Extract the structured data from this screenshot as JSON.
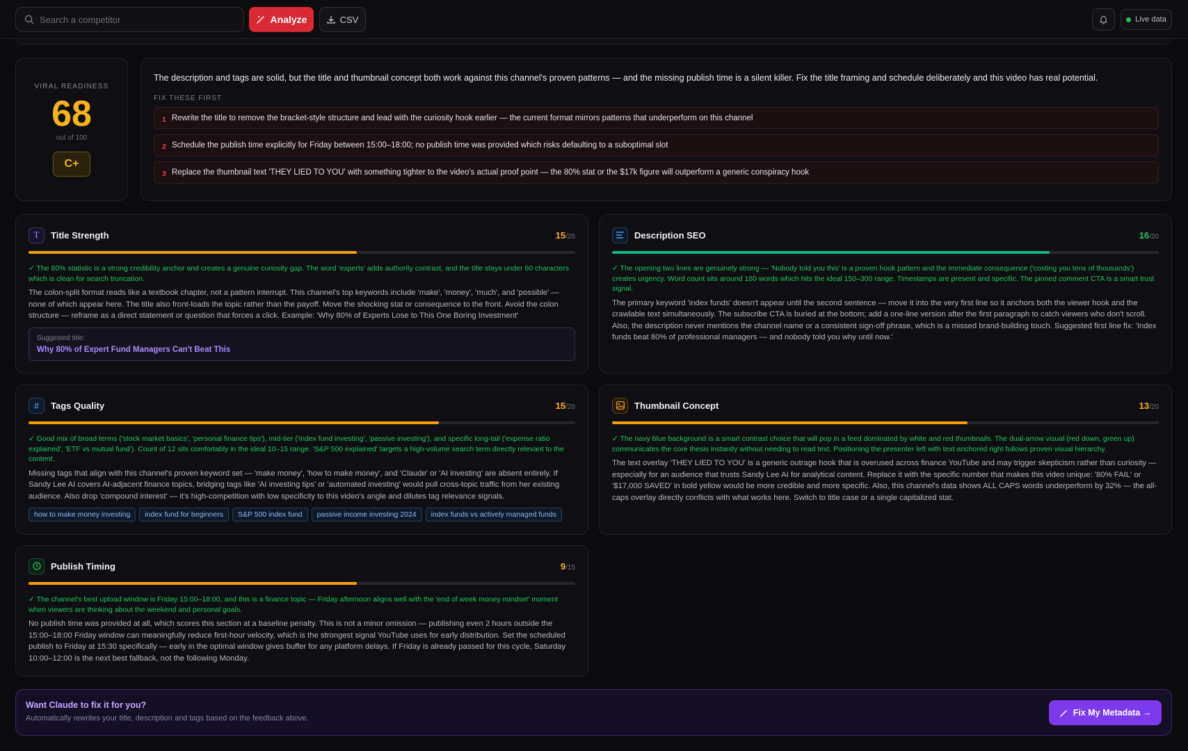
{
  "topbar": {
    "search_placeholder": "Search a competitor",
    "analyze_label": "Analyze",
    "csv_label": "CSV",
    "live_label": "Live data"
  },
  "score": {
    "label": "VIRAL READINESS",
    "value": "68",
    "out_of": "out of 100",
    "grade": "C+"
  },
  "summary": {
    "text": "The description and tags are solid, but the title and thumbnail concept both work against this channel's proven patterns — and the missing publish time is a silent killer. Fix the title framing and schedule deliberately and this video has real potential.",
    "fix_title": "FIX THESE FIRST",
    "fixes": [
      {
        "num": "1",
        "text": "Rewrite the title to remove the bracket-style structure and lead with the curiosity hook earlier — the current format mirrors patterns that underperform on this channel"
      },
      {
        "num": "2",
        "text": "Schedule the publish time explicitly for Friday between 15:00–18:00; no publish time was provided which risks defaulting to a suboptimal slot"
      },
      {
        "num": "3",
        "text": "Replace the thumbnail text 'THEY LIED TO YOU' with something tighter to the video's actual proof point — the 80% stat or the $17k figure will outperform a generic conspiracy hook"
      }
    ]
  },
  "sections": {
    "title": {
      "name": "Title Strength",
      "score": "15",
      "max": "/25",
      "progress": 0.6,
      "good": "✓ The 80% statistic is a strong credibility anchor and creates a genuine curiosity gap. The word 'experts' adds authority contrast, and the title stays under 60 characters which is clean for search truncation.",
      "body": "The colon-split format reads like a textbook chapter, not a pattern interrupt. This channel's top keywords include 'make', 'money', 'much', and 'possible' — none of which appear here. The title also front-loads the topic rather than the payoff. Move the shocking stat or consequence to the front. Avoid the colon structure — reframe as a direct statement or question that forces a click. Example: 'Why 80% of Experts Lose to This One Boring Investment'",
      "suggest_label": "Suggested title:",
      "suggest_value": "Why 80% of Expert Fund Managers Can't Beat This"
    },
    "description": {
      "name": "Description SEO",
      "score": "16",
      "max": "/20",
      "progress": 0.8,
      "good": "✓ The opening two lines are genuinely strong — 'Nobody told you this' is a proven hook pattern and the immediate consequence ('costing you tens of thousands') creates urgency. Word count sits around 180 words which hits the ideal 150–300 range. Timestamps are present and specific. The pinned comment CTA is a smart trust signal.",
      "body": "The primary keyword 'index funds' doesn't appear until the second sentence — move it into the very first line so it anchors both the viewer hook and the crawlable text simultaneously. The subscribe CTA is buried at the bottom; add a one-line version after the first paragraph to catch viewers who don't scroll. Also, the description never mentions the channel name or a consistent sign-off phrase, which is a missed brand-building touch. Suggested first line fix: 'Index funds beat 80% of professional managers — and nobody told you why until now.'"
    },
    "tags": {
      "name": "Tags Quality",
      "score": "15",
      "max": "/20",
      "progress": 0.75,
      "good": "✓ Good mix of broad terms ('stock market basics', 'personal finance tips'), mid-tier ('index fund investing', 'passive investing'), and specific long-tail ('expense ratio explained', 'ETF vs mutual fund'). Count of 12 sits comfortably in the ideal 10–15 range. 'S&P 500 explained' targets a high-volume search term directly relevant to the content.",
      "body": "Missing tags that align with this channel's proven keyword set — 'make money', 'how to make money', and 'Claude' or 'AI investing' are absent entirely. If Sandy Lee AI covers AI-adjacent finance topics, bridging tags like 'AI investing tips' or 'automated investing' would pull cross-topic traffic from her existing audience. Also drop 'compound interest' — it's high-competition with low specificity to this video's angle and dilutes tag relevance signals.",
      "chips": [
        "how to make money investing",
        "index fund for beginners",
        "S&P 500 index fund",
        "passive income investing 2024",
        "index funds vs actively managed funds"
      ]
    },
    "thumbnail": {
      "name": "Thumbnail Concept",
      "score": "13",
      "max": "/20",
      "progress": 0.65,
      "good": "✓ The navy blue background is a smart contrast choice that will pop in a feed dominated by white and red thumbnails. The dual-arrow visual (red down, green up) communicates the core thesis instantly without needing to read text. Positioning the presenter left with text anchored right follows proven visual hierarchy.",
      "body": "The text overlay 'THEY LIED TO YOU' is a generic outrage hook that is overused across finance YouTube and may trigger skepticism rather than curiosity — especially for an audience that trusts Sandy Lee AI for analytical content. Replace it with the specific number that makes this video unique: '80% FAIL' or '$17,000 SAVED' in bold yellow would be more credible and more specific. Also, this channel's data shows ALL CAPS words underperform by 32% — the all-caps overlay directly conflicts with what works here. Switch to title case or a single capitalized stat."
    },
    "timing": {
      "name": "Publish Timing",
      "score": "9",
      "max": "/15",
      "progress": 0.6,
      "good": "✓ The channel's best upload window is Friday 15:00–18:00, and this is a finance topic — Friday afternoon aligns well with the 'end of week money mindset' moment when viewers are thinking about the weekend and personal goals.",
      "body": "No publish time was provided at all, which scores this section at a baseline penalty. This is not a minor omission — publishing even 2 hours outside the 15:00–18:00 Friday window can meaningfully reduce first-hour velocity, which is the strongest signal YouTube uses for early distribution. Set the scheduled publish to Friday at 15:30 specifically — early in the optimal window gives buffer for any platform delays. If Friday is already passed for this cycle, Saturday 10:00–12:00 is the next best fallback, not the following Monday."
    }
  },
  "cta": {
    "title": "Want Claude to fix it for you?",
    "subtitle": "Automatically rewrites your title, description and tags based on the feedback above.",
    "button": "Fix My Metadata →"
  },
  "colors": {
    "accent_red": "#d92a33",
    "score_amber": "#f5b21b",
    "good_green": "#22c55e",
    "purple": "#7c3aed"
  },
  "icons": {
    "search": "search-icon",
    "analyze": "magic-wand-icon",
    "csv": "download-icon",
    "bell": "bell-icon",
    "title": "type-icon",
    "description": "align-left-icon",
    "tags": "hash-icon",
    "thumbnail": "image-icon",
    "timing": "clock-icon"
  }
}
